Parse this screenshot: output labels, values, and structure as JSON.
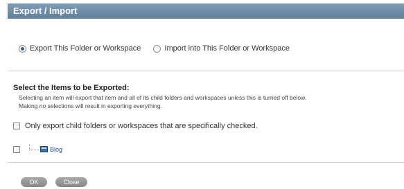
{
  "dialog": {
    "title": "Export / Import"
  },
  "mode": {
    "options": [
      {
        "label": "Export This Folder or Workspace",
        "selected": true
      },
      {
        "label": "Import into This Folder or Workspace",
        "selected": false
      }
    ]
  },
  "selection": {
    "heading": "Select the Items to be Exported:",
    "help_line1": "Selecting an item will export that item and all of its child folders and workspaces unless this is turned off below.",
    "help_line2": "Making no selections will result in exporting everything.",
    "only_checked_label": "Only export child folders or workspaces that are specifically checked.",
    "only_checked": false
  },
  "tree": {
    "items": [
      {
        "label": "Blog",
        "icon": "blog-icon",
        "checked": false
      }
    ]
  },
  "buttons": {
    "ok": "OK",
    "close": "Close"
  },
  "colors": {
    "titlebar": "#6f8eab",
    "link": "#1a4fa0",
    "button": "#999999"
  }
}
